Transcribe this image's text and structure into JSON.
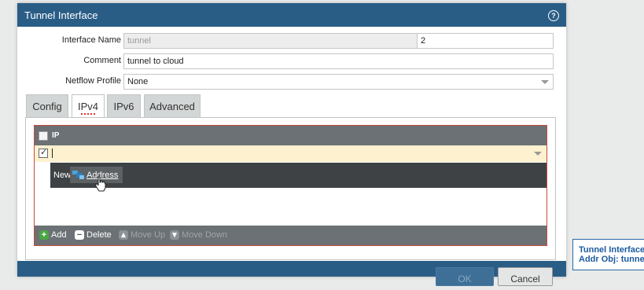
{
  "dialog": {
    "title": "Tunnel Interface",
    "help_icon": "help-icon",
    "fields": {
      "interface_name": {
        "label": "Interface Name",
        "value": "tunnel"
      },
      "interface_dot": ".",
      "interface_number": {
        "value": "2"
      },
      "comment": {
        "label": "Comment",
        "value": "tunnel to cloud"
      },
      "netflow_profile": {
        "label": "Netflow Profile",
        "value": "None"
      }
    },
    "tabs": [
      {
        "label": "Config",
        "active": false
      },
      {
        "label": "IPv4",
        "active": true
      },
      {
        "label": "IPv6",
        "active": false
      },
      {
        "label": "Advanced",
        "active": false
      }
    ],
    "ip_table": {
      "header": "IP",
      "edit_row": {
        "value": "",
        "checked": true
      },
      "dropdown_menu": {
        "new_label": "New",
        "item_label": "Address",
        "item_icon": "address-object-icon"
      },
      "toolbar": {
        "add": "Add",
        "delete": "Delete",
        "move_up": "Move Up",
        "move_down": "Move Down"
      }
    },
    "footer": {
      "ok": "OK",
      "cancel": "Cancel"
    }
  },
  "tooltip": {
    "line1": "Tunnel Interface",
    "line2": "Addr Obj: tunne"
  },
  "colors": {
    "titlebar": "#2a5d86",
    "grid_header": "#6b7174",
    "edit_row": "#fdf1cf",
    "grid_border": "#c64a3a",
    "tooltip_text": "#1c5aa0"
  }
}
